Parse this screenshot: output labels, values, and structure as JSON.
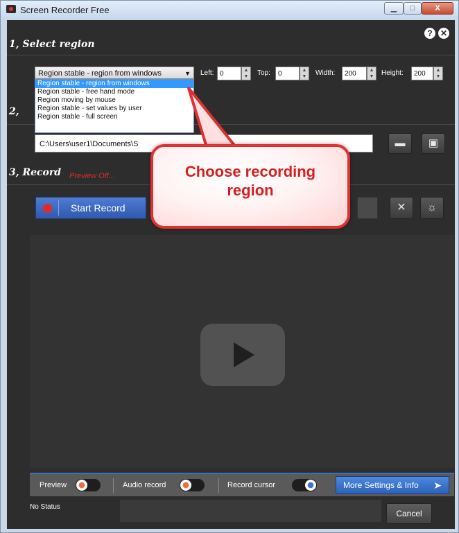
{
  "window": {
    "title": "Screen Recorder Free",
    "min_label": "▁",
    "max_label": "□",
    "close_label": "X"
  },
  "section1": {
    "title": "1, Select region",
    "help_glyph": "?",
    "close_glyph": "✕",
    "region_mode": "Region stable - region from windows",
    "left_label": "Left:",
    "left_value": "0",
    "top_label": "Top:",
    "top_value": "0",
    "width_label": "Width:",
    "width_value": "200",
    "height_label": "Height:",
    "height_value": "200",
    "dropdown_options": [
      "Region stable - region from windows",
      "Region stable - free hand mode",
      "Region moving by mouse",
      "Region stable - set values by user",
      "Region stable - full screen"
    ]
  },
  "section2": {
    "num": "2,",
    "path": "C:\\Users\\user1\\Documents\\S"
  },
  "section3": {
    "title": "3, Record",
    "preview_status": "Preview Off...",
    "start_label": "Start Record"
  },
  "callout": {
    "line1": "Choose recording",
    "line2": "region"
  },
  "options": {
    "preview_label": "Preview",
    "audio_label": "Audio record",
    "cursor_label": "Record cursor",
    "more_label": "More Settings & Info"
  },
  "status": {
    "text": "No Status",
    "cancel_label": "Cancel"
  },
  "colors": {
    "accent": "#3d6fbf",
    "record_red": "#e02a2a",
    "callout_red": "#d42020"
  }
}
